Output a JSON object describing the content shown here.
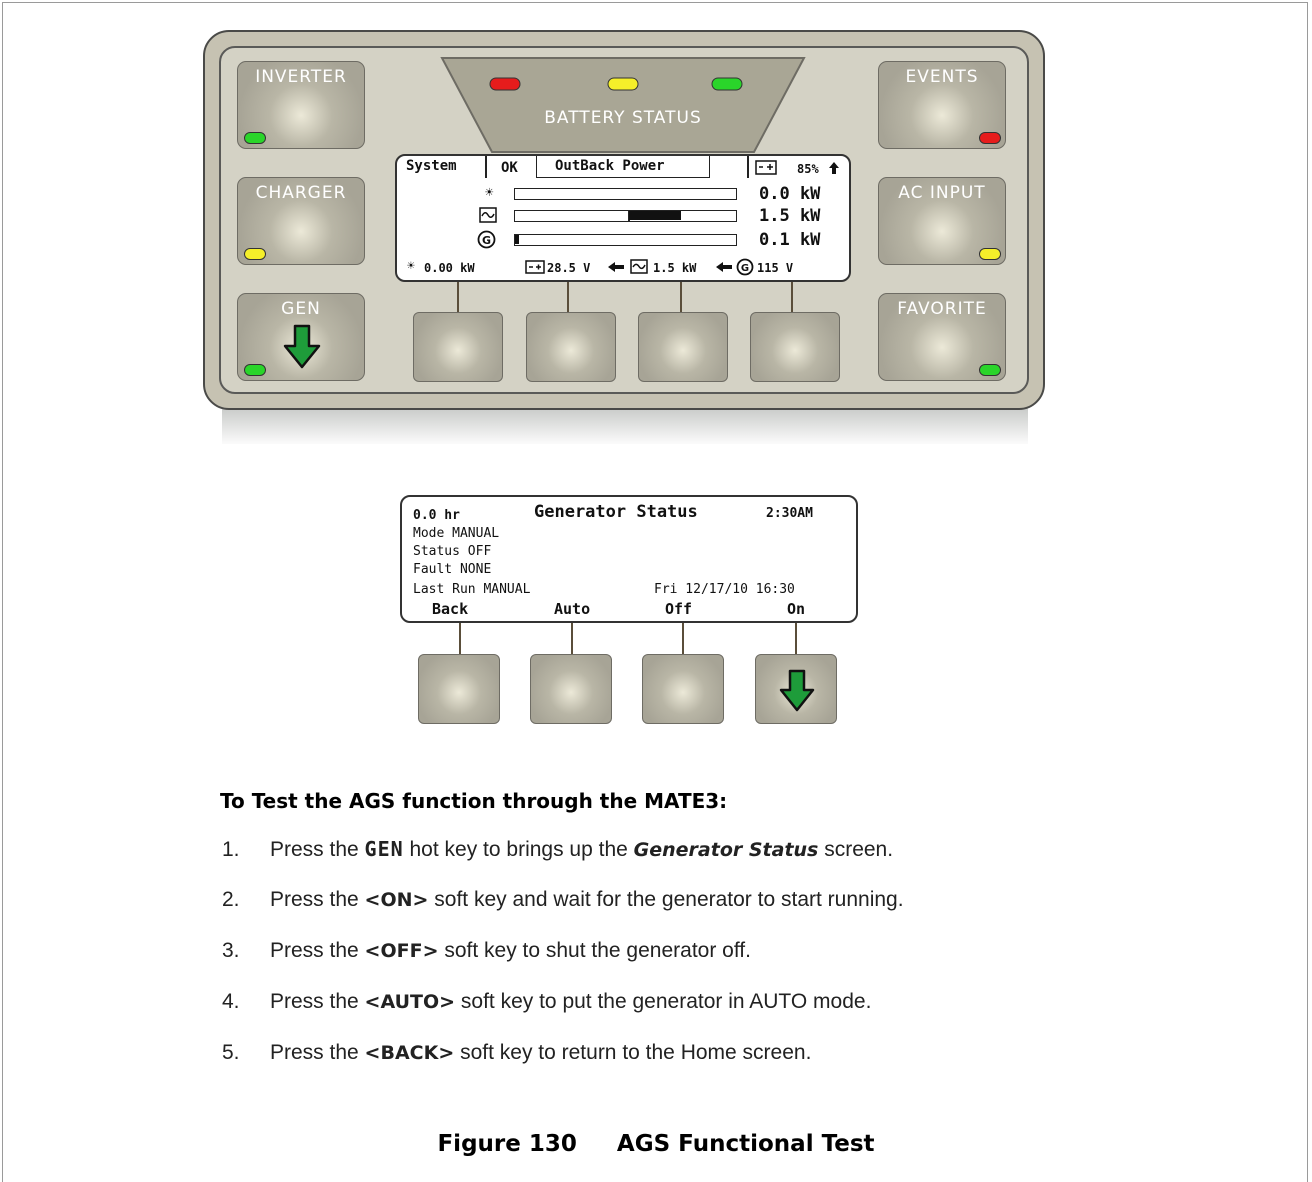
{
  "panel": {
    "hotkeys": {
      "inverter": "INVERTER",
      "charger": "CHARGER",
      "gen": "GEN",
      "events": "EVENTS",
      "ac_input": "AC INPUT",
      "favorite": "FAVORITE"
    },
    "battery_status": "BATTERY STATUS",
    "led_colors": {
      "red": "#e61c1c",
      "yellow": "#f5ef2a",
      "green": "#2ad52a"
    },
    "lcd": {
      "tab_system": "System",
      "tab_ok": "OK",
      "tab_brand": "OutBack Power",
      "battery_pct": "85%",
      "rows": [
        {
          "icon": "sun-icon",
          "value": "0.0 kW",
          "fill": 0
        },
        {
          "icon": "ac-wave-icon",
          "value": "1.5 kW",
          "fill": 0.75
        },
        {
          "icon": "generator-icon",
          "value": "0.1 kW",
          "fill": 0.02
        }
      ],
      "footer": {
        "solar": "0.00 kW",
        "battery_v": "28.5 V",
        "inverter_kw": "1.5 kW",
        "gen_v": "115 V"
      }
    }
  },
  "gen_screen": {
    "hours": "0.0 hr",
    "title": "Generator Status",
    "time": "2:30AM",
    "mode": "Mode  MANUAL",
    "status": "Status  OFF",
    "fault": "Fault NONE",
    "last_run": "Last Run MANUAL",
    "last_run_date": "Fri 12/17/10 16:30",
    "softkeys": [
      "Back",
      "Auto",
      "Off",
      "On"
    ]
  },
  "instructions": {
    "heading": "To Test the AGS function through the MATE3:",
    "steps": [
      {
        "num": "1.",
        "pre": "Press the ",
        "key": "GEN",
        "mid": " hot key to brings up the ",
        "em": "Generator Status",
        "post": " screen."
      },
      {
        "num": "2.",
        "pre": "Press the ",
        "key": "<ON>",
        "post": " soft key and wait for the generator to start running."
      },
      {
        "num": "3.",
        "pre": "Press the ",
        "key": "<OFF>",
        "post": " soft key to shut the generator off."
      },
      {
        "num": "4.",
        "pre": "Press the ",
        "key": "<AUTO>",
        "post": " soft key to put the generator in AUTO mode."
      },
      {
        "num": "5.",
        "pre": "Press the ",
        "key": "<BACK>",
        "post": " soft key to return to the Home screen."
      }
    ]
  },
  "caption": {
    "label": "Figure 130",
    "title": "AGS Functional Test"
  }
}
